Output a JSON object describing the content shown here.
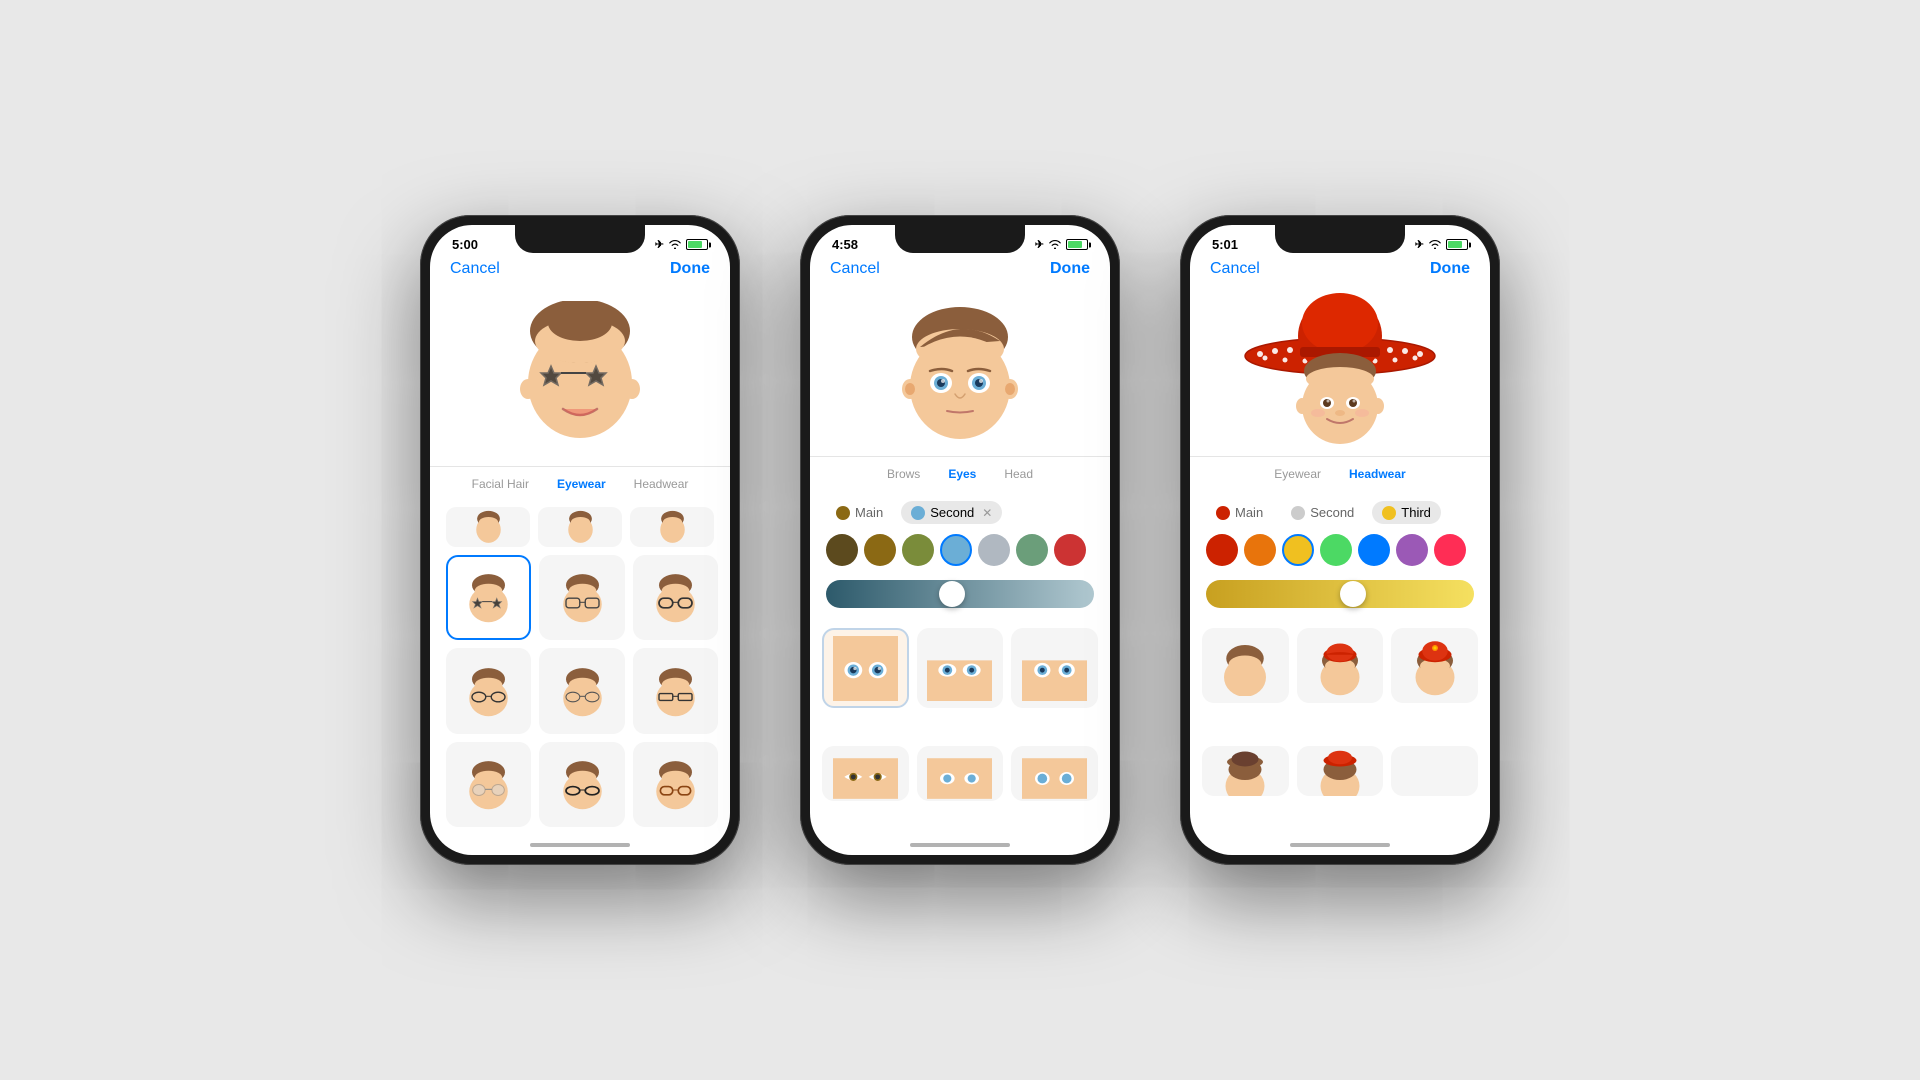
{
  "phones": [
    {
      "id": "phone1",
      "statusBar": {
        "time": "5:00",
        "moon": "☾",
        "airplane": "✈",
        "wifi": "wifi",
        "battery": "green"
      },
      "nav": {
        "cancel": "Cancel",
        "done": "Done"
      },
      "tabs": [
        {
          "label": "Facial Hair",
          "active": false
        },
        {
          "label": "Eyewear",
          "active": true
        },
        {
          "label": "Headwear",
          "active": false
        }
      ],
      "selectedTab": "Eyewear",
      "avatarEmoji": "😎",
      "hasGlasses": true
    },
    {
      "id": "phone2",
      "statusBar": {
        "time": "4:58",
        "moon": "☾",
        "airplane": "✈",
        "wifi": "wifi",
        "battery": "green"
      },
      "nav": {
        "cancel": "Cancel",
        "done": "Done"
      },
      "tabs": [
        {
          "label": "Brows",
          "active": false
        },
        {
          "label": "Eyes",
          "active": true
        },
        {
          "label": "Head",
          "active": false
        }
      ],
      "selectedTab": "Eyes",
      "colorTabs": [
        {
          "label": "Main",
          "color": "#8B6914",
          "active": false
        },
        {
          "label": "Second",
          "color": "#6baed6",
          "active": true,
          "hasClose": true
        }
      ],
      "eyeColors": [
        "#5c4a1e",
        "#8B6914",
        "#7a8c3a",
        "#6baed6",
        "#b0b8c1",
        "#6b9e7a",
        "#cc3333"
      ],
      "sliderGradient": "linear-gradient(to right, #2d5a6b, #b0c8d0)",
      "sliderPosition": 45
    },
    {
      "id": "phone3",
      "statusBar": {
        "time": "5:01",
        "moon": "☾",
        "airplane": "✈",
        "wifi": "wifi",
        "battery": "green"
      },
      "nav": {
        "cancel": "Cancel",
        "done": "Done"
      },
      "tabs": [
        {
          "label": "Eyewear",
          "active": false
        },
        {
          "label": "Headwear",
          "active": true
        }
      ],
      "selectedTab": "Headwear",
      "colorTabs": [
        {
          "label": "Main",
          "color": "#cc2200",
          "active": false
        },
        {
          "label": "Second",
          "color": "#cccccc",
          "active": false
        },
        {
          "label": "Third",
          "color": "#f0c020",
          "active": true
        }
      ],
      "hatColors": [
        "#cc2200",
        "#e8740c",
        "#f0c020",
        "#4cd964",
        "#007aff",
        "#9b59b6",
        "#ff2d55"
      ],
      "sliderGradient": "linear-gradient(to right, #c8a020, #f5e060)",
      "sliderPosition": 55
    }
  ]
}
